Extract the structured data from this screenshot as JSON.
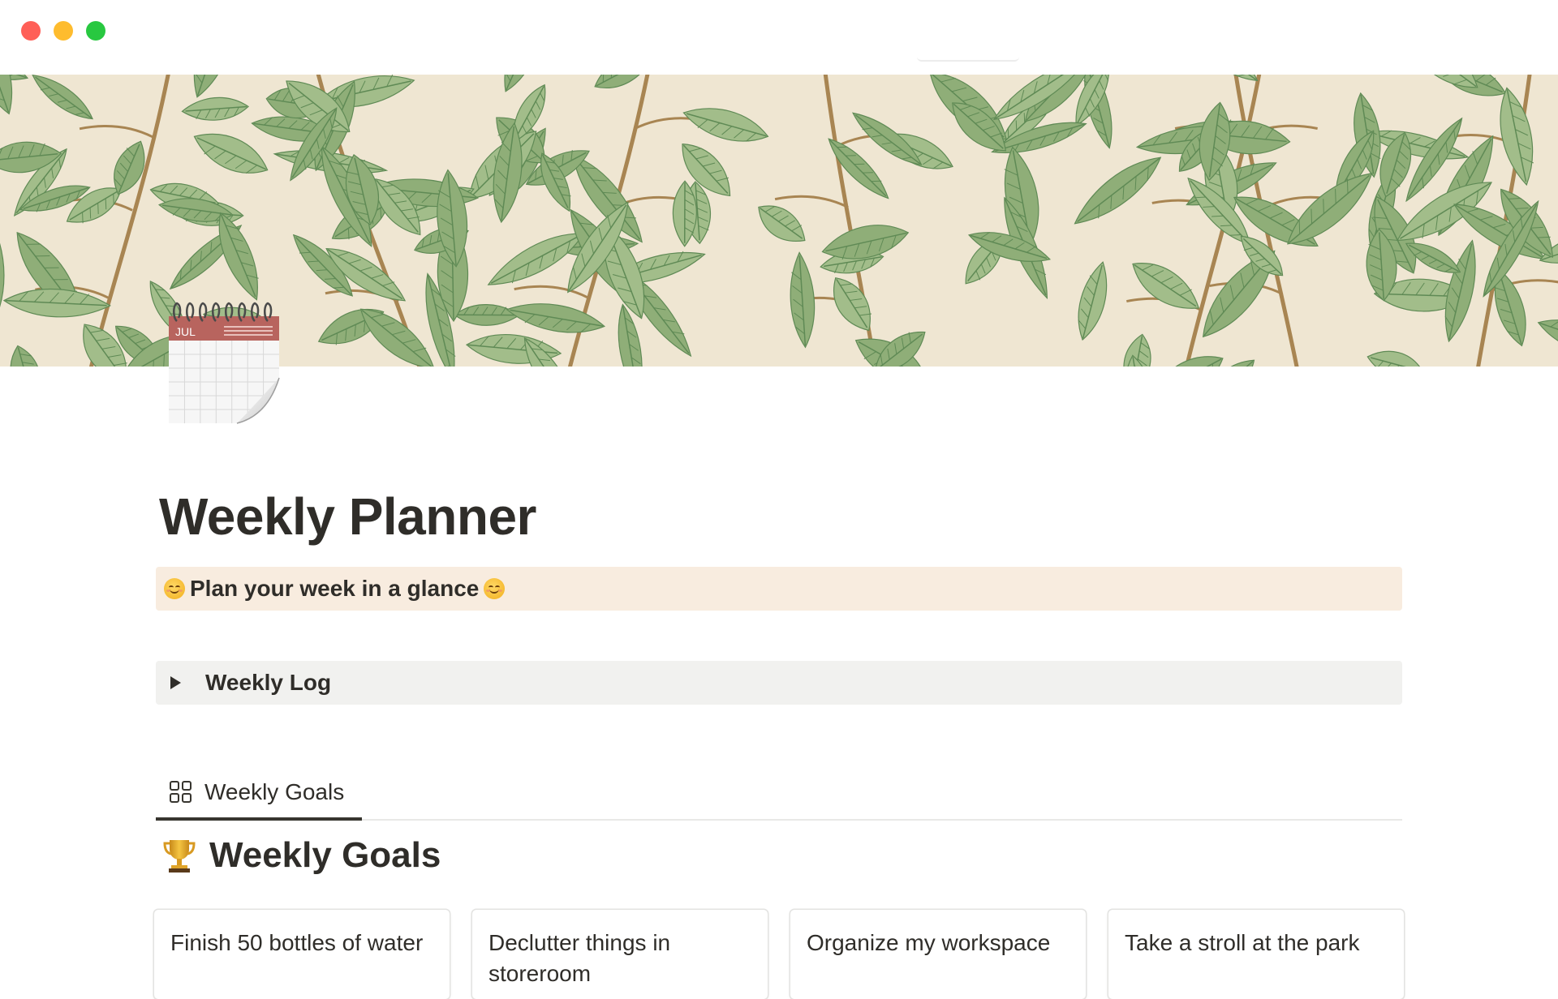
{
  "window": {
    "controls": [
      "close",
      "minimize",
      "zoom"
    ]
  },
  "cover": {
    "description_colors": {
      "background": "#efe6d2",
      "leaf": "#8fae78",
      "leaf_dark": "#5f8a55",
      "branch": "#a88552"
    }
  },
  "page": {
    "icon": "calendar-icon",
    "icon_month": "JUL",
    "title": "Weekly Planner",
    "callout_text": "Plan your week in a glance",
    "callout_emoji": "smiling-face-icon"
  },
  "toggle": {
    "label": "Weekly Log",
    "state": "collapsed"
  },
  "views": {
    "tabs": [
      {
        "label": "Weekly Goals",
        "icon": "gallery-grid-icon",
        "active": true
      }
    ]
  },
  "goals": {
    "heading": "Weekly Goals",
    "heading_icon": "trophy-icon",
    "cards": [
      {
        "title": "Finish 50 bottles of water"
      },
      {
        "title": "Declutter things in storeroom"
      },
      {
        "title": "Organize my workspace"
      },
      {
        "title": "Take a stroll at the park"
      }
    ]
  },
  "colors": {
    "text": "#37352f",
    "callout_bg": "#f8ecdf",
    "toggle_bg": "#f1f1ef",
    "divider": "#e9e9e7"
  }
}
